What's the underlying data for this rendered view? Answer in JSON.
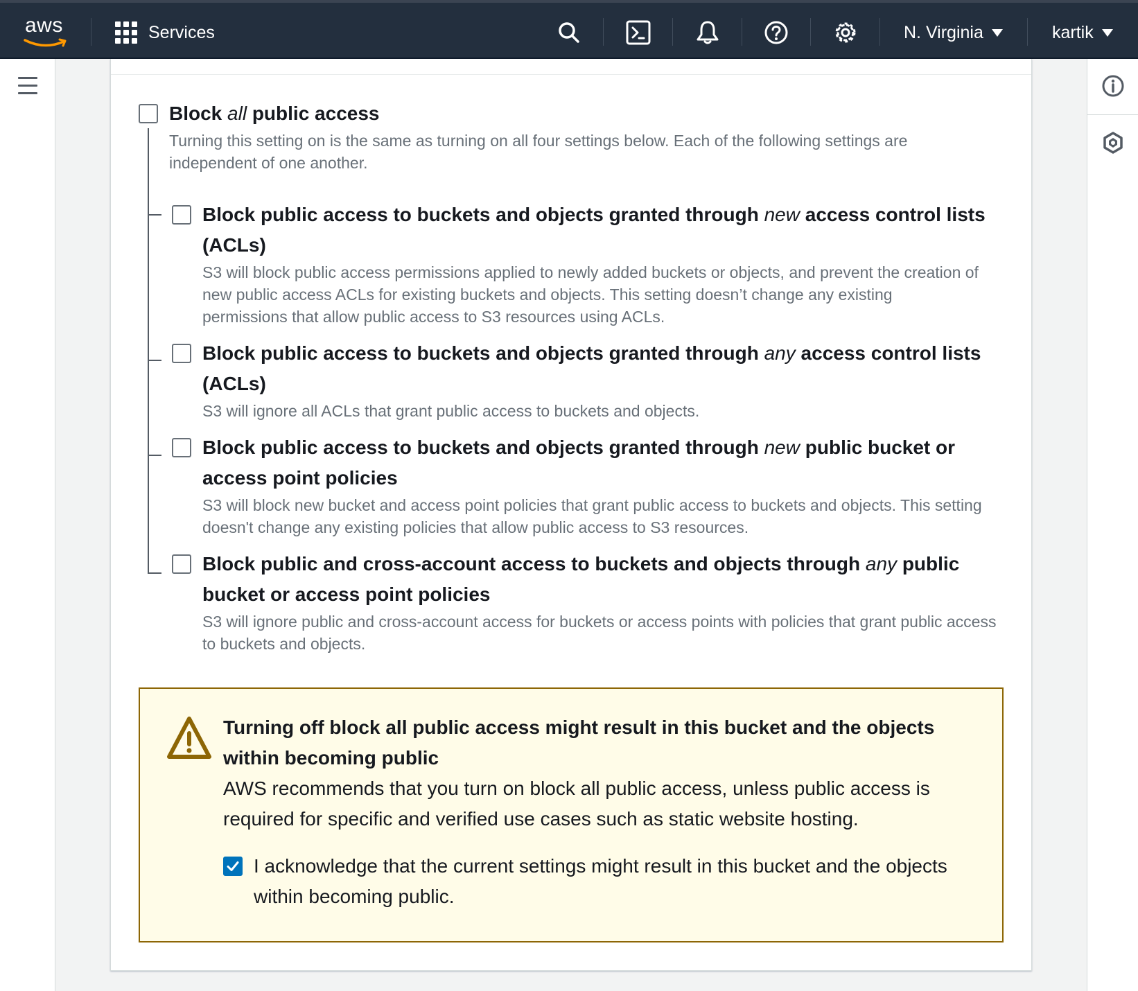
{
  "topnav": {
    "logo_text": "aws",
    "services_label": "Services",
    "region_label": "N. Virginia",
    "account_label": "kartik"
  },
  "block_all": {
    "label_pre": "Block ",
    "label_em": "all",
    "label_post": " public access",
    "description": "Turning this setting on is the same as turning on all four settings below. Each of the following settings are independent of one another.",
    "checked": false
  },
  "settings": [
    {
      "label_pre": "Block public access to buckets and objects granted through ",
      "label_em": "new",
      "label_post": " access control lists (ACLs)",
      "description": "S3 will block public access permissions applied to newly added buckets or objects, and prevent the creation of new public access ACLs for existing buckets and objects. This setting doesn’t change any existing permissions that allow public access to S3 resources using ACLs.",
      "checked": false
    },
    {
      "label_pre": "Block public access to buckets and objects granted through ",
      "label_em": "any",
      "label_post": " access control lists (ACLs)",
      "description": "S3 will ignore all ACLs that grant public access to buckets and objects.",
      "checked": false
    },
    {
      "label_pre": "Block public access to buckets and objects granted through ",
      "label_em": "new",
      "label_post": " public bucket or access point policies",
      "description": "S3 will block new bucket and access point policies that grant public access to buckets and objects. This setting doesn't change any existing policies that allow public access to S3 resources.",
      "checked": false
    },
    {
      "label_pre": "Block public and cross-account access to buckets and objects through ",
      "label_em": "any",
      "label_post": " public bucket or access point policies",
      "description": "S3 will ignore public and cross-account access for buckets or access points with policies that grant public access to buckets and objects.",
      "checked": false
    }
  ],
  "warning": {
    "title": "Turning off block all public access might result in this bucket and the objects within becoming public",
    "body": "AWS recommends that you turn on block all public access, unless public access is required for specific and verified use cases such as static website hosting.",
    "acknowledge_label": "I acknowledge that the current settings might result in this bucket and the objects within becoming public.",
    "acknowledge_checked": true
  },
  "colors": {
    "nav_bg": "#232f3e",
    "accent_orange": "#ff9900",
    "checkbox_blue": "#0073bb",
    "warning_border": "#8d6605",
    "warning_bg": "#fffce8"
  }
}
